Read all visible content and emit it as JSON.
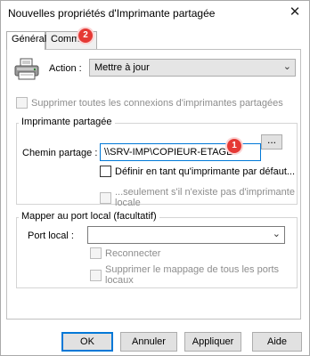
{
  "window": {
    "title": "Nouvelles propriétés d'Imprimante partagée",
    "close_glyph": "✕"
  },
  "tabs": [
    {
      "label": "Général",
      "active": true
    },
    {
      "label": "Commun",
      "active": false
    }
  ],
  "badges": [
    "2",
    "1"
  ],
  "general": {
    "action_label": "Action :",
    "action_value": "Mettre à jour",
    "delete_all_label": "Supprimer toutes les connexions d'imprimantes partagées",
    "group_printer_title": "Imprimante partagée",
    "share_path_label": "Chemin partage :",
    "share_path_value": "\\\\SRV-IMP\\COPIEUR-ETAGE",
    "browse_label": "...",
    "set_default_label": "Définir en tant qu'imprimante par défaut...",
    "only_if_none_label": "...seulement s'il n'existe pas d'imprimante locale",
    "group_port_title": "Mapper au port local (facultatif)",
    "local_port_label": "Port local :",
    "local_port_value": "",
    "reconnect_label": "Reconnecter",
    "unmap_all_label": "Supprimer le mappage de tous les ports locaux"
  },
  "buttons": {
    "ok": "OK",
    "cancel": "Annuler",
    "apply": "Appliquer",
    "help": "Aide"
  },
  "colors": {
    "focus_blue": "#0078d7",
    "badge_red": "#e53935"
  },
  "icons": {
    "printer": "printer-icon",
    "chevron": "chevron-down-icon",
    "close": "close-icon"
  }
}
